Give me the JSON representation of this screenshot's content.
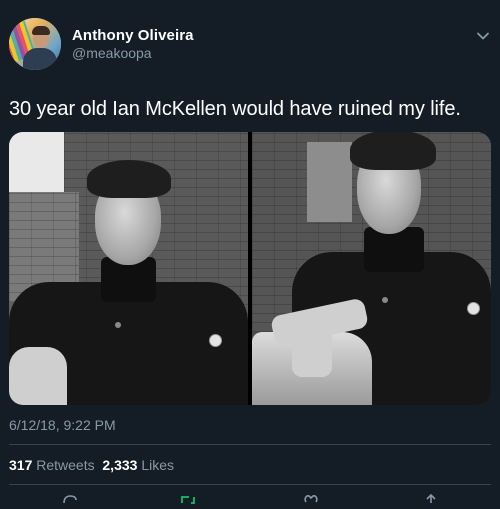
{
  "author": {
    "name": "Anthony Oliveira",
    "handle": "@meakoopa"
  },
  "tweet": {
    "text": "30 year old Ian McKellen would have ruined my life.",
    "timestamp": "6/12/18, 9:22 PM"
  },
  "stats": {
    "retweets_count": "317",
    "retweets_label": "Retweets",
    "likes_count": "2,333",
    "likes_label": "Likes"
  },
  "icons": {
    "menu": "chevron-down-icon",
    "reply": "reply-icon",
    "retweet": "retweet-icon",
    "like": "heart-icon",
    "share": "share-icon"
  },
  "colors": {
    "background": "#141d26",
    "secondary_text": "#8899a6",
    "divider": "#38444d",
    "retweet_accent": "#17bf63"
  }
}
